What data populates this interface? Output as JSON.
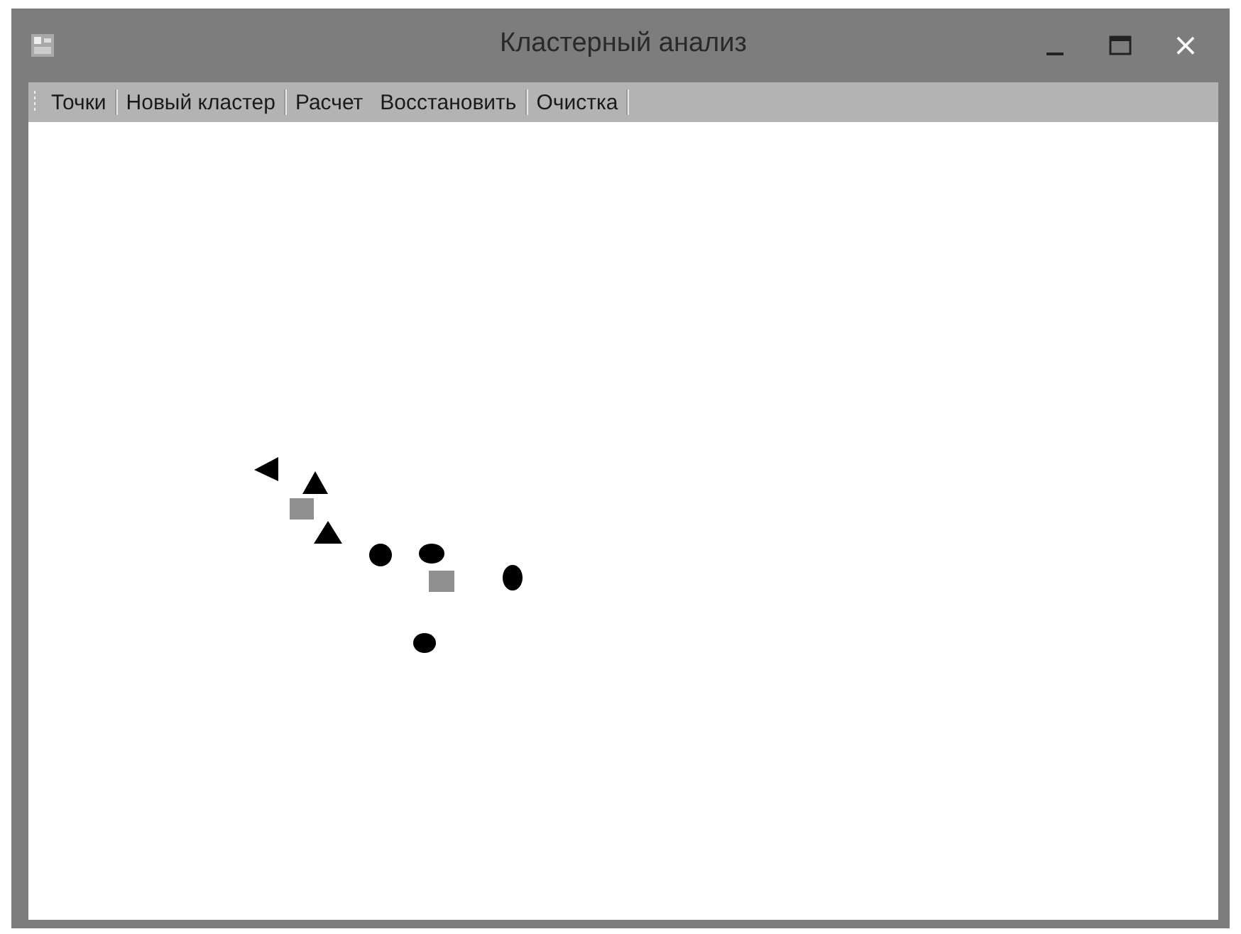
{
  "window": {
    "title": "Кластерный анализ"
  },
  "toolbar": {
    "items": [
      {
        "label": "Точки",
        "separator_after": true
      },
      {
        "label": "Новый кластер",
        "separator_after": true
      },
      {
        "label": "Расчет",
        "separator_after": false
      },
      {
        "label": "Восстановить",
        "separator_after": true
      },
      {
        "label": "Очистка",
        "separator_after": true
      }
    ]
  },
  "window_controls": [
    {
      "kind": "minimize"
    },
    {
      "kind": "maximize"
    },
    {
      "kind": "close",
      "label": "×"
    }
  ]
}
